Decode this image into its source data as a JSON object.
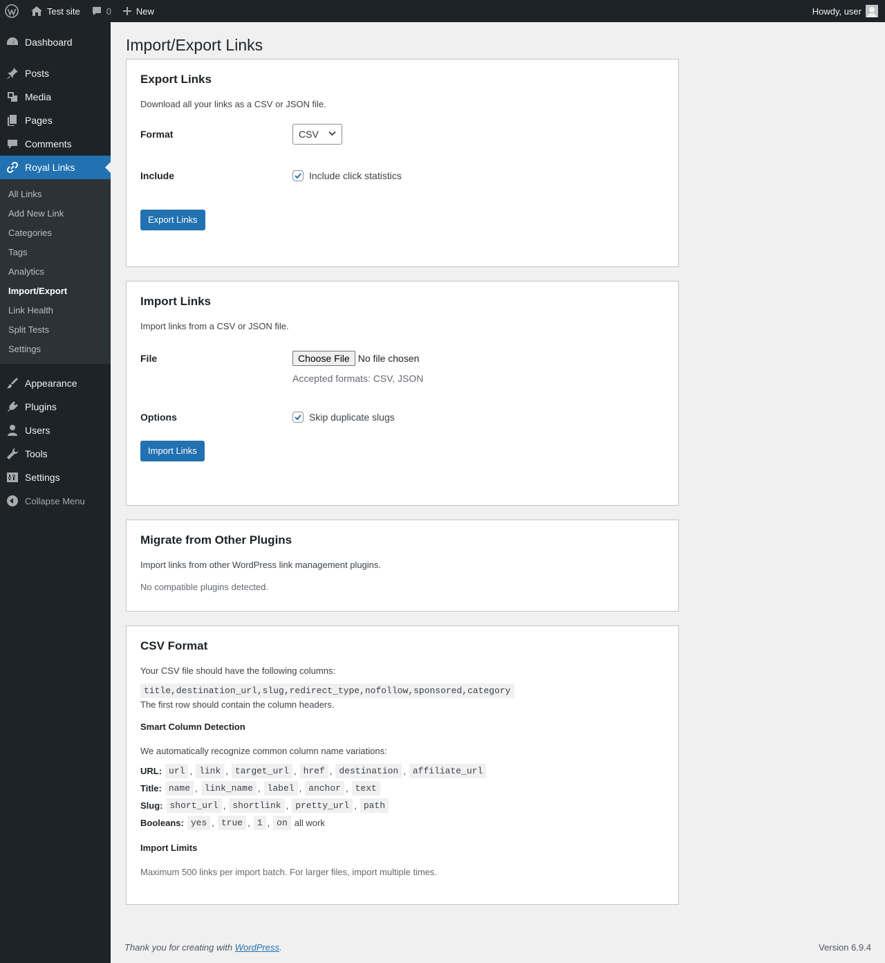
{
  "adminbar": {
    "site_name": "Test site",
    "comments_count": "0",
    "new_label": "New",
    "howdy": "Howdy, user"
  },
  "sidebar": {
    "items": [
      {
        "label": "Dashboard",
        "icon": "dashboard-icon"
      },
      {
        "label": "Posts",
        "icon": "pin-icon"
      },
      {
        "label": "Media",
        "icon": "media-icon"
      },
      {
        "label": "Pages",
        "icon": "pages-icon"
      },
      {
        "label": "Comments",
        "icon": "comment-icon"
      },
      {
        "label": "Royal Links",
        "icon": "link-icon"
      },
      {
        "label": "Appearance",
        "icon": "brush-icon"
      },
      {
        "label": "Plugins",
        "icon": "plugin-icon"
      },
      {
        "label": "Users",
        "icon": "user-icon"
      },
      {
        "label": "Tools",
        "icon": "wrench-icon"
      },
      {
        "label": "Settings",
        "icon": "settings-icon"
      }
    ],
    "submenu": [
      "All Links",
      "Add New Link",
      "Categories",
      "Tags",
      "Analytics",
      "Import/Export",
      "Link Health",
      "Split Tests",
      "Settings"
    ],
    "collapse_label": "Collapse Menu"
  },
  "page": {
    "title": "Import/Export Links"
  },
  "export": {
    "title": "Export Links",
    "description": "Download all your links as a CSV or JSON file.",
    "format_label": "Format",
    "format_value": "CSV",
    "include_label": "Include",
    "include_option": "Include click statistics",
    "button": "Export Links"
  },
  "import": {
    "title": "Import Links",
    "description": "Import links from a CSV or JSON file.",
    "file_label": "File",
    "choose_file": "Choose File",
    "no_file": "No file chosen",
    "accepted": "Accepted formats: CSV, JSON",
    "options_label": "Options",
    "skip_option": "Skip duplicate slugs",
    "button": "Import Links"
  },
  "migrate": {
    "title": "Migrate from Other Plugins",
    "description": "Import links from other WordPress link management plugins.",
    "status": "No compatible plugins detected."
  },
  "csv": {
    "title": "CSV Format",
    "intro": "Your CSV file should have the following columns:",
    "columns": "title,destination_url,slug,redirect_type,nofollow,sponsored,category",
    "header_note": "The first row should contain the column headers.",
    "smart_title": "Smart Column Detection",
    "smart_desc": "We automatically recognize common column name variations:",
    "url_label": "URL:",
    "url_keys": [
      "url",
      "link",
      "target_url",
      "href",
      "destination",
      "affiliate_url"
    ],
    "title_label": "Title:",
    "title_keys": [
      "name",
      "link_name",
      "label",
      "anchor",
      "text"
    ],
    "slug_label": "Slug:",
    "slug_keys": [
      "short_url",
      "shortlink",
      "pretty_url",
      "path"
    ],
    "bool_label": "Booleans:",
    "bool_keys": [
      "yes",
      "true",
      "1",
      "on"
    ],
    "bool_suffix": "all work",
    "limits_title": "Import Limits",
    "limits_desc": "Maximum 500 links per import batch. For larger files, import multiple times."
  },
  "footer": {
    "thanks_prefix": "Thank you for creating with ",
    "thanks_link": "WordPress",
    "thanks_suffix": ".",
    "version": "Version 6.9.4"
  }
}
